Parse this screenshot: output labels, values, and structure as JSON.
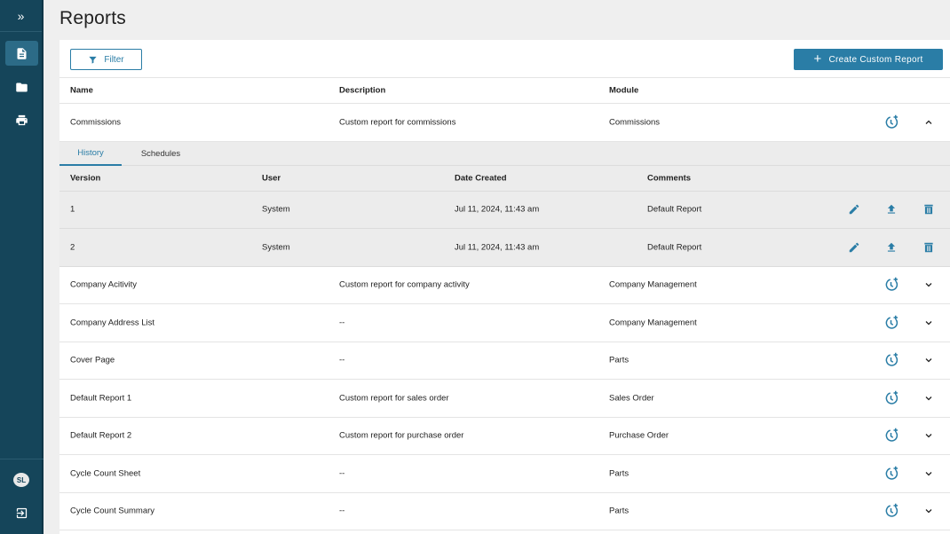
{
  "sidebar": {
    "expand_label": "»",
    "avatar_initials": "SL"
  },
  "page": {
    "title": "Reports"
  },
  "toolbar": {
    "filter_label": "Filter",
    "create_label": "Create Custom Report"
  },
  "table": {
    "headers": {
      "name": "Name",
      "description": "Description",
      "module": "Module"
    },
    "rows": [
      {
        "name": "Commissions",
        "description": "Custom report for commissions",
        "module": "Commissions",
        "expanded": true
      },
      {
        "name": "Company Acitivity",
        "description": "Custom report for company activity",
        "module": "Company Management"
      },
      {
        "name": "Company Address List",
        "description": "--",
        "module": "Company Management"
      },
      {
        "name": "Cover Page",
        "description": "--",
        "module": "Parts"
      },
      {
        "name": "Default Report 1",
        "description": "Custom report for sales order",
        "module": "Sales Order"
      },
      {
        "name": "Default Report 2",
        "description": "Custom report for purchase order",
        "module": "Purchase Order"
      },
      {
        "name": "Cycle Count Sheet",
        "description": "--",
        "module": "Parts"
      },
      {
        "name": "Cycle Count Summary",
        "description": "--",
        "module": "Parts"
      }
    ]
  },
  "detail": {
    "tabs": [
      "History",
      "Schedules"
    ],
    "active_tab": "History",
    "headers": {
      "version": "Version",
      "user": "User",
      "date": "Date Created",
      "comments": "Comments"
    },
    "rows": [
      {
        "version": "1",
        "user": "System",
        "date": "Jul 11, 2024, 11:43 am",
        "comments": "Default Report"
      },
      {
        "version": "2",
        "user": "System",
        "date": "Jul 11, 2024, 11:43 am",
        "comments": "Default Report"
      }
    ]
  },
  "icons": {
    "sidebar": [
      "expand-icon",
      "document-icon",
      "folder-icon",
      "printer-icon",
      "logout-icon"
    ],
    "row_actions": [
      "schedule-icon",
      "chevron-icon"
    ],
    "history_actions": [
      "edit-icon",
      "upload-icon",
      "delete-icon"
    ]
  },
  "colors": {
    "sidebar": "#15455a",
    "accent": "#2a7da6",
    "background": "#efefef"
  }
}
